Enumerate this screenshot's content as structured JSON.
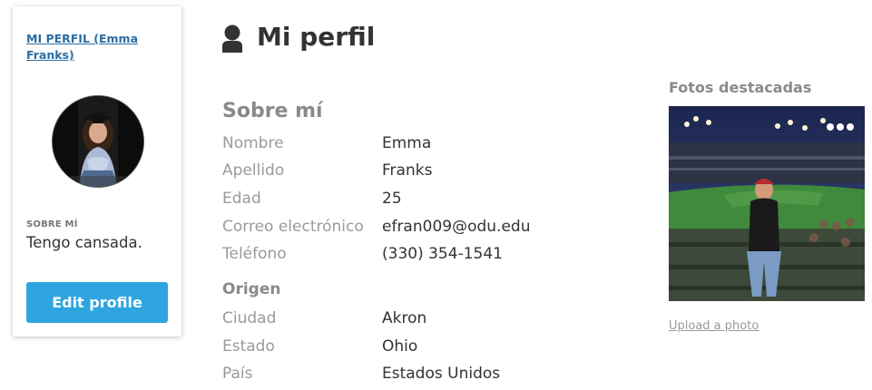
{
  "sidebar": {
    "profile_link": "MI PERFIL (Emma Franks)",
    "about_label": "SOBRE MÍ",
    "about_text": "Tengo cansada.",
    "edit_button": "Edit profile"
  },
  "header": {
    "title": "Mi perfil",
    "icon": "person-icon"
  },
  "about": {
    "section_title": "Sobre mí",
    "fields": [
      {
        "label": "Nombre",
        "value": "Emma"
      },
      {
        "label": "Apellido",
        "value": "Franks"
      },
      {
        "label": "Edad",
        "value": "25"
      },
      {
        "label": "Correo electrónico",
        "value": "efran009@odu.edu"
      },
      {
        "label": "Teléfono",
        "value": "(330) 354-1541"
      }
    ]
  },
  "origin": {
    "section_title": "Origen",
    "fields": [
      {
        "label": "Ciudad",
        "value": "Akron"
      },
      {
        "label": "Estado",
        "value": "Ohio"
      },
      {
        "label": "País",
        "value": "Estados Unidos"
      }
    ]
  },
  "photos": {
    "title": "Fotos destacadas",
    "upload_link": "Upload a photo"
  },
  "colors": {
    "accent_button": "#2ea5e0",
    "link": "#2c6da3",
    "label_gray": "#9a9a9a"
  }
}
